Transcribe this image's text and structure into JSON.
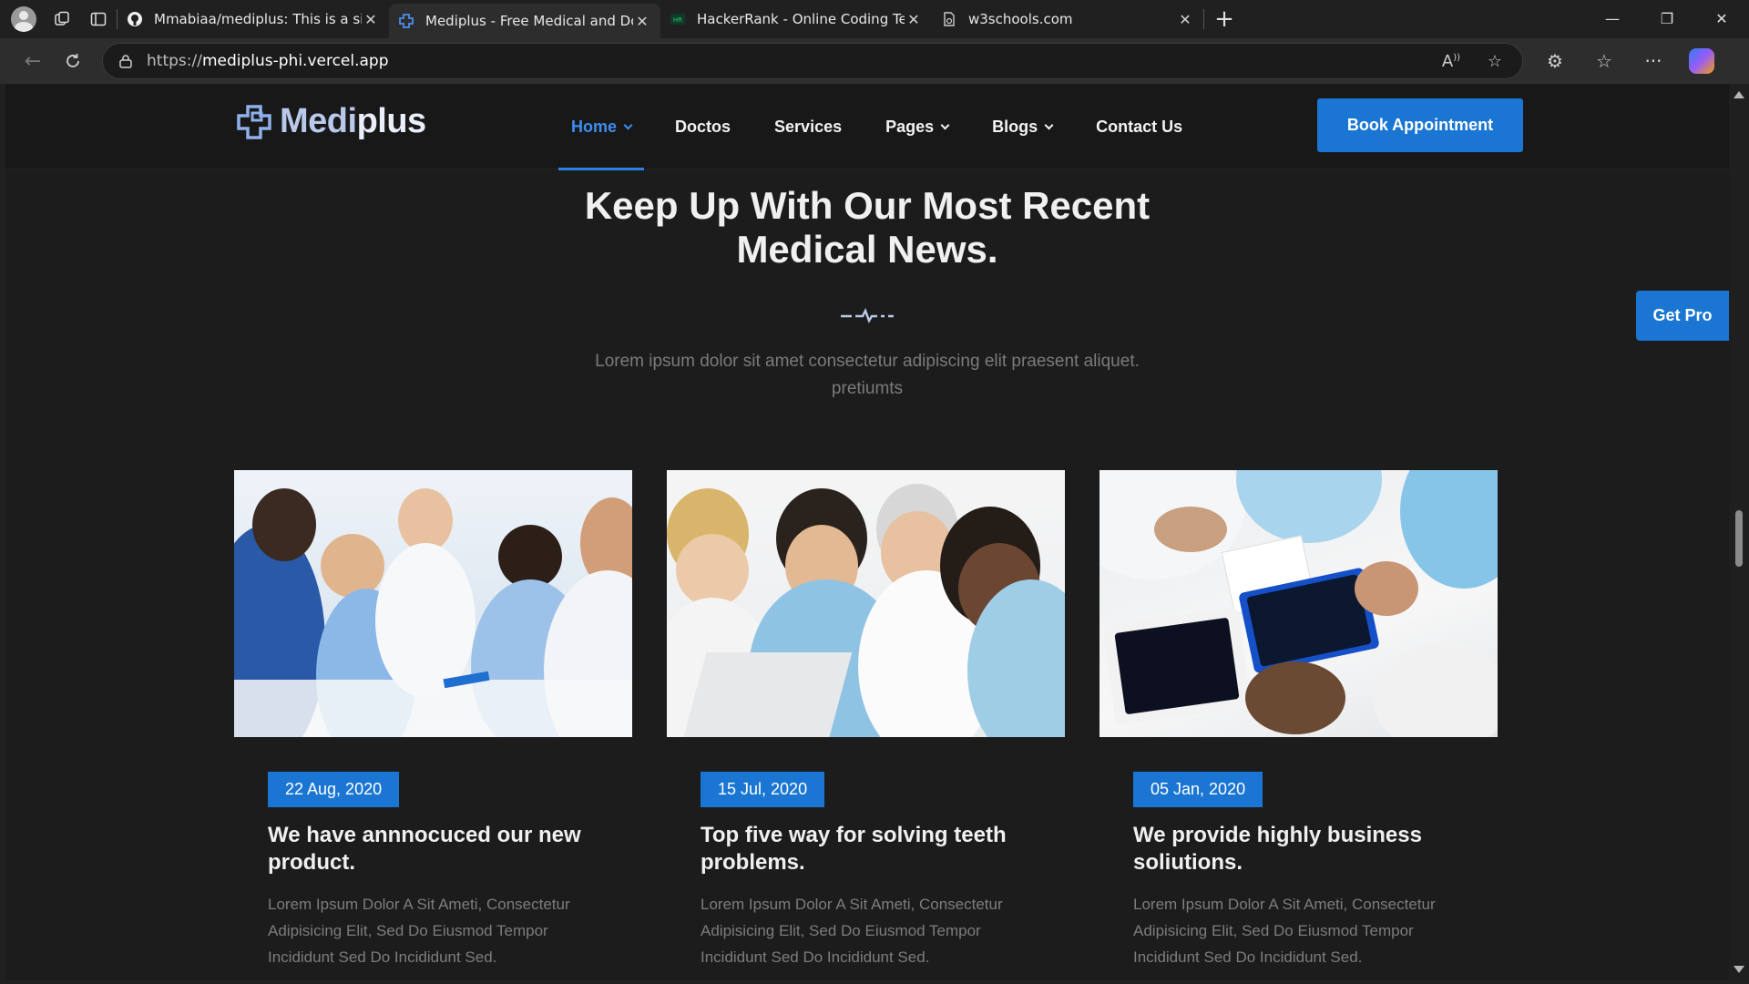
{
  "browser": {
    "tabs": [
      {
        "title": "Mmabiaa/mediplus: This is a simp",
        "favicon": "github-icon",
        "active": false
      },
      {
        "title": "Mediplus - Free Medical and Doct",
        "favicon": "mediplus-icon",
        "active": true
      },
      {
        "title": "HackerRank - Online Coding Test:",
        "favicon": "hackerrank-icon",
        "active": false
      },
      {
        "title": "w3schools.com",
        "favicon": "page-icon",
        "active": false
      }
    ],
    "url_scheme": "https://",
    "url_host": "mediplus-phi.vercel.app"
  },
  "site": {
    "logo": {
      "prefix": "Medi",
      "suffix": "plus"
    },
    "nav": [
      {
        "label": "Home",
        "dropdown": true,
        "active": true
      },
      {
        "label": "Doctos",
        "dropdown": false,
        "active": false
      },
      {
        "label": "Services",
        "dropdown": false,
        "active": false
      },
      {
        "label": "Pages",
        "dropdown": true,
        "active": false
      },
      {
        "label": "Blogs",
        "dropdown": true,
        "active": false
      },
      {
        "label": "Contact Us",
        "dropdown": false,
        "active": false
      }
    ],
    "book_button": "Book Appointment",
    "get_pro": "Get Pro",
    "section": {
      "title_line1": "Keep Up With Our Most Recent",
      "title_line2": "Medical News.",
      "subtitle_line1": "Lorem ipsum dolor sit amet consectetur adipiscing elit praesent aliquet.",
      "subtitle_line2": "pretiumts"
    },
    "news": [
      {
        "date": "22 Aug, 2020",
        "title": "We have annnocuced our new product.",
        "text": "Lorem Ipsum Dolor A Sit Ameti, Consectetur Adipisicing Elit, Sed Do Eiusmod Tempor Incididunt Sed Do Incididunt Sed."
      },
      {
        "date": "15 Jul, 2020",
        "title": "Top five way for solving teeth problems.",
        "text": "Lorem Ipsum Dolor A Sit Ameti, Consectetur Adipisicing Elit, Sed Do Eiusmod Tempor Incididunt Sed Do Incididunt Sed."
      },
      {
        "date": "05 Jan, 2020",
        "title": "We provide highly business soliutions.",
        "text": "Lorem Ipsum Dolor A Sit Ameti, Consectetur Adipisicing Elit, Sed Do Eiusmod Tempor Incididunt Sed Do Incididunt Sed."
      }
    ]
  },
  "colors": {
    "accent": "#1a76d2",
    "active_nav": "#3d8ef0",
    "page_bg": "#1c1c1c"
  }
}
